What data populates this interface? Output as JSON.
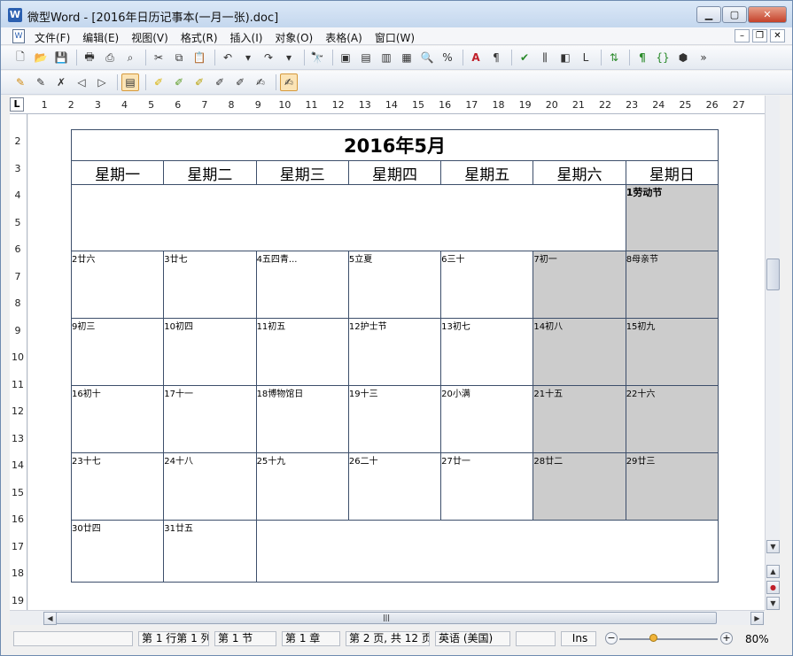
{
  "window": {
    "title": "微型Word - [2016年日历记事本(一月一张).doc]",
    "app_icon": "W"
  },
  "menu": {
    "items": [
      "文件(F)",
      "编辑(E)",
      "视图(V)",
      "格式(R)",
      "插入(I)",
      "对象(O)",
      "表格(A)",
      "窗口(W)"
    ]
  },
  "ruler": {
    "h_numbers": [
      "1",
      "2",
      "3",
      "4",
      "5",
      "6",
      "7",
      "8",
      "9",
      "10",
      "11",
      "12",
      "13",
      "14",
      "15",
      "16",
      "17",
      "18",
      "19",
      "20",
      "21",
      "22",
      "23",
      "24",
      "25",
      "26",
      "27"
    ],
    "v_numbers": [
      "2",
      "3",
      "4",
      "5",
      "6",
      "7",
      "8",
      "9",
      "10",
      "11",
      "12",
      "13",
      "14",
      "15",
      "16",
      "17",
      "18",
      "19"
    ],
    "corner": "L"
  },
  "calendar": {
    "title": "2016年5月",
    "weekdays": [
      "星期一",
      "星期二",
      "星期三",
      "星期四",
      "星期五",
      "星期六",
      "星期日"
    ],
    "weeks": [
      [
        "",
        "",
        "",
        "",
        "",
        "",
        "1劳动节"
      ],
      [
        "2廿六",
        "3廿七",
        "4五四青...",
        "5立夏",
        "6三十",
        "7初一",
        "8母亲节"
      ],
      [
        "9初三",
        "10初四",
        "11初五",
        "12护士节",
        "13初七",
        "14初八",
        "15初九"
      ],
      [
        "16初十",
        "17十一",
        "18博物馆日",
        "19十三",
        "20小满",
        "21十五",
        "22十六"
      ],
      [
        "23十七",
        "24十八",
        "25十九",
        "26二十",
        "27廿一",
        "28廿二",
        "29廿三"
      ],
      [
        "30廿四",
        "31廿五",
        "",
        "",
        "",
        "",
        ""
      ]
    ]
  },
  "status": {
    "position": "第 1 行第 1 列",
    "section": "第 1 节",
    "chapter": "第 1 章",
    "page": "第 2 页, 共 12 页",
    "language": "英语 (美国)",
    "mode": "Ins",
    "zoom": "80%"
  },
  "colors": {
    "weekend_fill": "#cccccc",
    "table_border": "#3d4f6b"
  }
}
